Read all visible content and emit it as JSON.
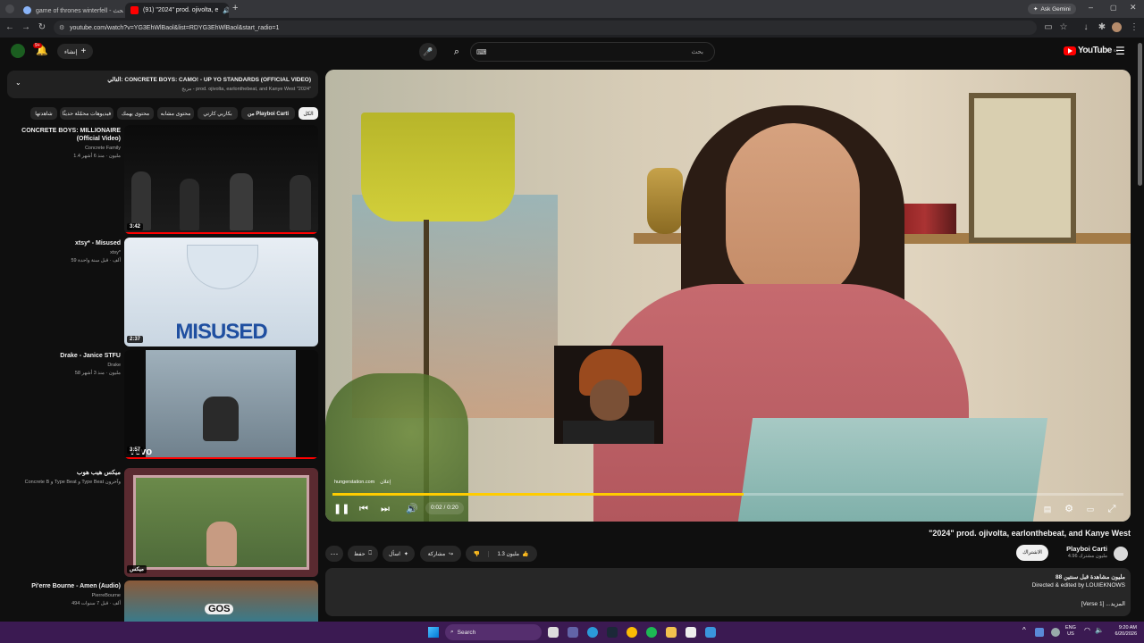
{
  "browser": {
    "tabs": [
      {
        "title": "game of thrones winterfell - بحث",
        "active": false
      },
      {
        "title": "(91) \"2024\" prod. ojivolta, e",
        "active": true
      }
    ],
    "url": "youtube.com/watch?v=YG3EhWlBaol&list=RDYG3EhWlBaol&start_radio=1",
    "ask_gemini": "Ask Gemini"
  },
  "masthead": {
    "logo_text": "YouTube",
    "logo_region": "SA",
    "search_placeholder": "بحث",
    "create_label": "إنشاء",
    "notification_count": "9+"
  },
  "playlist": {
    "now_playing_prefix": "التالي:",
    "now_playing_title": "CONCRETE BOYS: CAMO! - UP YO STANDARDS (OFFICIAL VIDEO)",
    "subtitle": "مزيج - prod. ojivolta, earlonthebeat, and Kanye West \"2024\"",
    "chips": [
      "الكل",
      "من Playboi Carti",
      "بكاريي كارتي",
      "محتوى مشابه",
      "محتوى يهمك",
      "فيديوهات محمّلة حديثًا",
      "شاهدتها"
    ],
    "items": [
      {
        "title": "CONCRETE BOYS: MILLIONAIRE (Official Video)",
        "channel": "Concrete Family",
        "meta": "1.4 مليون · منذ 6 أشهر",
        "duration": "3:42"
      },
      {
        "title": "xtsy* - Misused",
        "channel": "xtsy*",
        "meta": "59 ألف · قبل سنة واحدة",
        "duration": "2:37",
        "thumb_text": "MISUSED"
      },
      {
        "title": "Drake - Janice STFU",
        "channel": "Drake",
        "meta": "58 مليون · منذ 3 أشهر",
        "duration": "3:57",
        "thumb_text": "vevo"
      },
      {
        "title": "ميكس هيب هوب",
        "channel": "Concrete B و Type Beat و Type Beat وآخرون",
        "meta": "",
        "duration": "",
        "thumb_text": "ميكس"
      },
      {
        "title": "Pi'erre Bourne - Amen (Audio)",
        "channel": "PierreBourne",
        "meta": "494 ألف · قبل 7 سنوات",
        "duration": "",
        "thumb_text": "GOS"
      }
    ]
  },
  "player": {
    "time": "0:02 / 0:20",
    "progress": 0.52,
    "ad_site": "hungerstation.com",
    "ad_label": "إعلان"
  },
  "video": {
    "title": "\"2024\" prod. ojivolta, earlonthebeat, and Kanye West",
    "channel": "Playboi Carti",
    "subscribers": "4.96 مليون مشترك",
    "subscribe_label": "الاشتراك",
    "like_count": "1.3 مليون",
    "share_label": "مشاركة",
    "ask_label": "اسأل",
    "save_label": "حفظ",
    "views": "88 مليون مشاهدة قبل سنتين",
    "desc_line1": "Directed & edited by LOUIEKNOWS",
    "desc_line2": "[Verse 1] ...المزيد"
  },
  "taskbar": {
    "search_label": "Search",
    "lang": "ENG",
    "region": "US",
    "time": "9:20 AM",
    "date": "6/20/2026"
  },
  "colors": {
    "accent_red": "#ff0000",
    "progress_yellow": "#ffcc00",
    "taskbar": "#3b1a52"
  }
}
